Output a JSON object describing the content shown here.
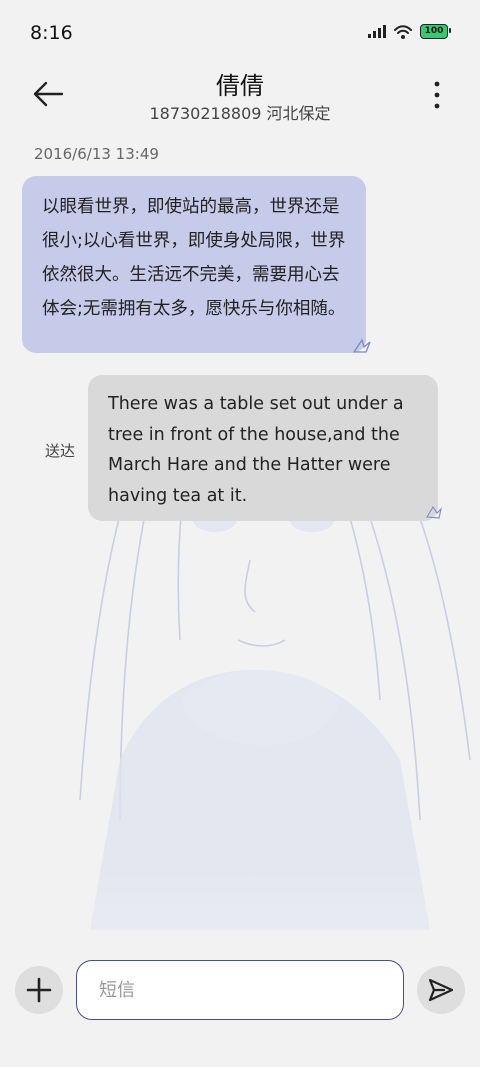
{
  "status_bar": {
    "time": "8:16",
    "battery": "100"
  },
  "header": {
    "contact_name": "倩倩",
    "contact_info": "18730218809 河北保定"
  },
  "conversation": {
    "timestamp": "2016/6/13 13:49",
    "received_message": "以眼看世界，即使站的最高，世界还是很小;以心看世界，即使身处局限，世界依然很大。生活远不完美，需要用心去体会;无需拥有太多，愿快乐与你相随。",
    "sent_message": "There was a table set out under a tree in front of the house,and the March Hare and the Hatter were having tea at it.",
    "sent_status": "送达"
  },
  "composer": {
    "placeholder": "短信"
  },
  "icons": {
    "back": "arrow-left-icon",
    "more": "more-vertical-icon",
    "add": "plus-icon",
    "send": "send-icon",
    "signal": "signal-icon",
    "wifi": "wifi-icon",
    "battery": "battery-icon"
  },
  "colors": {
    "received_bubble": "#c5cbe9",
    "sent_bubble": "#d9d9da",
    "input_border": "#46508a",
    "battery_fill": "#37c871",
    "background": "#f2f2f3"
  }
}
